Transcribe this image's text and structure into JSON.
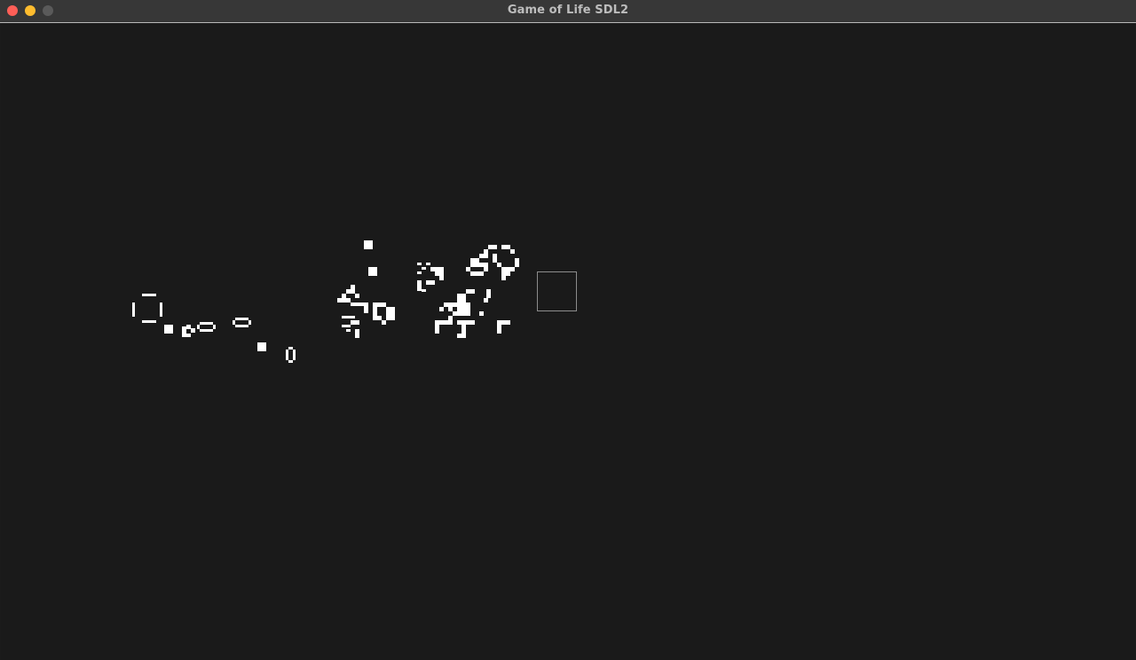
{
  "window": {
    "title": "Game of Life SDL2",
    "controls": [
      {
        "name": "close",
        "color": "#ff5f57"
      },
      {
        "name": "minimize",
        "color": "#febc2e"
      },
      {
        "name": "zoom",
        "color": "#5a5a5a"
      }
    ]
  },
  "board": {
    "background_color": "#1a1a1a",
    "cell_color": "#ffffff",
    "cursor_color": "#8c8c8c"
  }
}
